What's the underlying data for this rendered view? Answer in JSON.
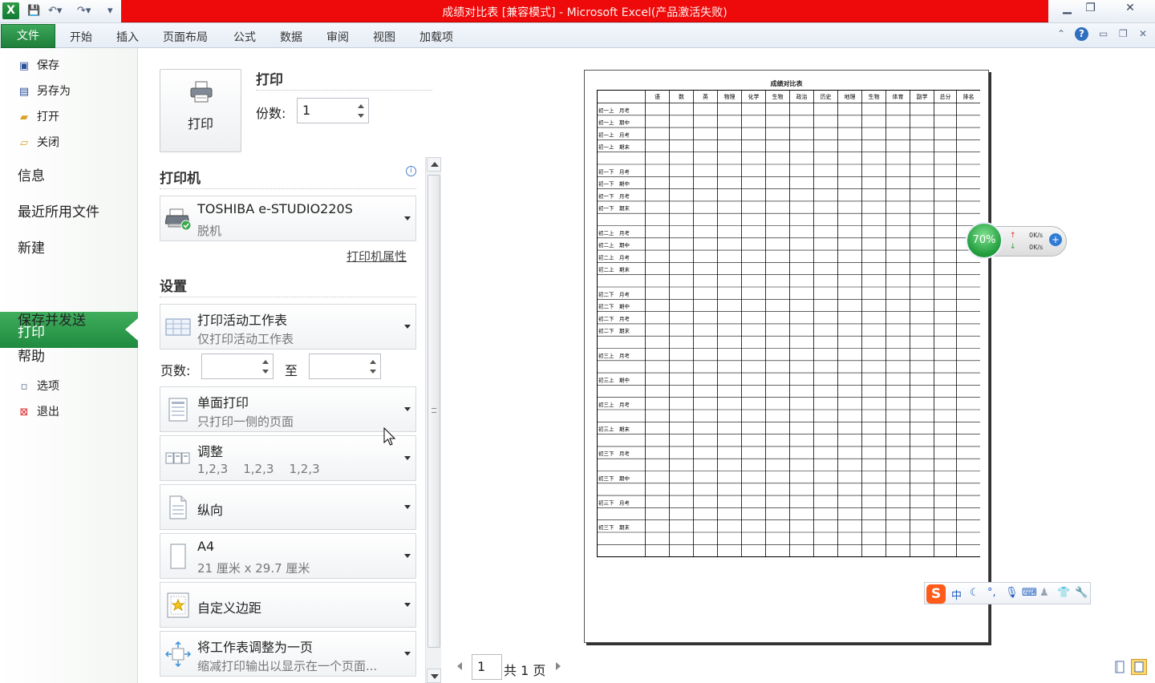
{
  "window": {
    "title": "成绩对比表  [兼容模式]  -  Microsoft Excel(产品激活失败)",
    "logo_letter": "X"
  },
  "tabs": [
    "文件",
    "开始",
    "插入",
    "页面布局",
    "公式",
    "数据",
    "审阅",
    "视图",
    "加载项"
  ],
  "nav": {
    "small_top": [
      {
        "label": "保存",
        "icon": "save-icon"
      },
      {
        "label": "另存为",
        "icon": "save-as-icon"
      },
      {
        "label": "打开",
        "icon": "open-folder-icon"
      },
      {
        "label": "关闭",
        "icon": "close-folder-icon"
      }
    ],
    "big": [
      "信息",
      "最近所用文件",
      "新建",
      "打印",
      "保存并发送",
      "帮助"
    ],
    "small_bottom": [
      {
        "label": "选项",
        "icon": "options-icon"
      },
      {
        "label": "退出",
        "icon": "exit-icon"
      }
    ]
  },
  "print": {
    "section_title": "打印",
    "button_label": "打印",
    "copies_label": "份数:",
    "copies_value": "1"
  },
  "printer": {
    "section_title": "打印机",
    "name": "TOSHIBA e-STUDIO220S",
    "status": "脱机",
    "properties_link": "打印机属性"
  },
  "settings": {
    "section_title": "设置",
    "scope": {
      "title": "打印活动工作表",
      "subtitle": "仅打印活动工作表"
    },
    "pages_label": "页数:",
    "pages_to_label": "至",
    "sides": {
      "title": "单面打印",
      "subtitle": "只打印一侧的页面"
    },
    "collate": {
      "title": "调整",
      "subtitle": "1,2,3    1,2,3    1,2,3"
    },
    "orientation": {
      "title": "纵向"
    },
    "paper": {
      "title": "A4",
      "subtitle": "21 厘米 x 29.7 厘米"
    },
    "margins": {
      "title": "自定义边距"
    },
    "scaling": {
      "title": "将工作表调整为一页",
      "subtitle": "缩减打印输出以显示在一个页面..."
    }
  },
  "preview": {
    "sheet_title": "成绩对比表",
    "headers": [
      "",
      "语",
      "数",
      "英",
      "物理",
      "化学",
      "生物",
      "政治",
      "历史",
      "地理",
      "生物",
      "体育",
      "副学",
      "总分",
      "排名"
    ],
    "row_labels": [
      "初一上　月考",
      "初一上　期中",
      "初一上　月考",
      "初一上　期末",
      "",
      "初一下　月考",
      "初一下　期中",
      "初一下　月考",
      "初一下　期末",
      "",
      "初二上　月考",
      "初二上　期中",
      "初二上　月考",
      "初二上　期末",
      "",
      "初二下　月考",
      "初二下　期中",
      "初二下　月考",
      "初二下　期末",
      "",
      "初三上　月考",
      "",
      "初三上　期中",
      "",
      "初三上　月考",
      "",
      "初三上　期末",
      "",
      "初三下　月考",
      "",
      "初三下　期中",
      "",
      "初三下　月考",
      "",
      "初三下　期末",
      "",
      ""
    ],
    "page_current": "1",
    "page_total": "共 1 页"
  },
  "overlays": {
    "speed_percent": "70%",
    "upload": "0K/s",
    "download": "0K/s",
    "ime_logo": "S",
    "ime_mode": "中"
  }
}
